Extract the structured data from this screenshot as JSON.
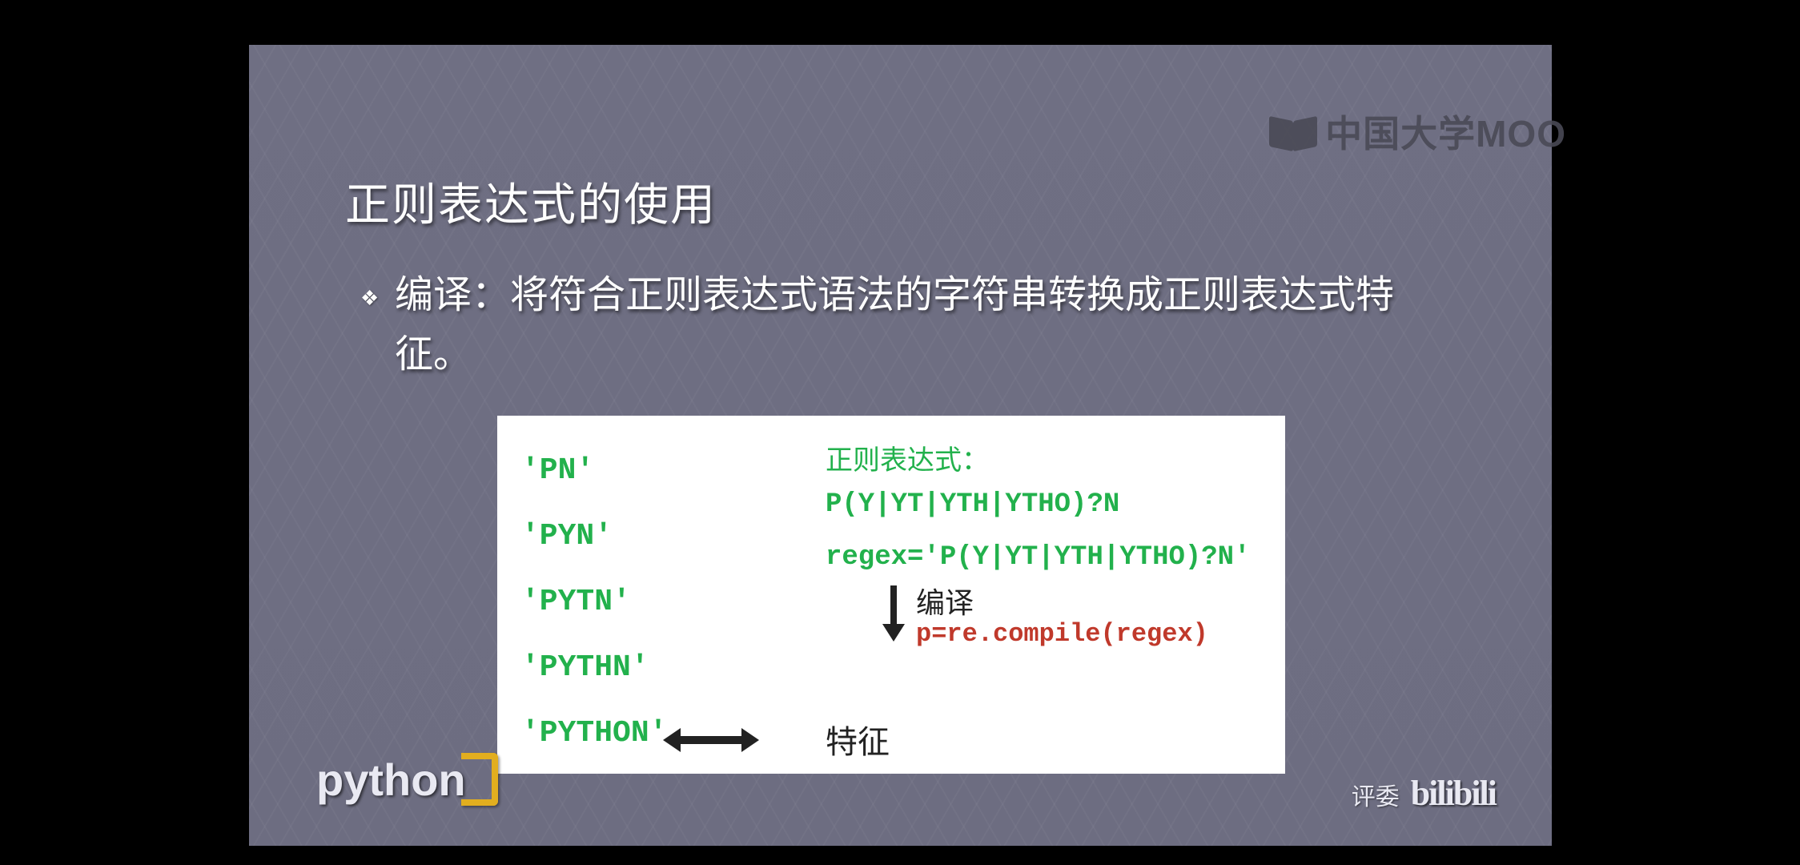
{
  "slide": {
    "title": "正则表达式的使用",
    "bullet": "编译：将符合正则表达式语法的字符串转换成正则表达式特征。"
  },
  "box": {
    "strings": [
      "'PN'",
      "'PYN'",
      "'PYTN'",
      "'PYTHN'",
      "'PYTHON'"
    ],
    "regex_label": "正则表达式：",
    "regex_expr": "P(Y|YT|YTH|YTHO)?N",
    "regex_assign": "regex='P(Y|YT|YTH|YTHO)?N'",
    "compile_word": "编译",
    "compile_code": "p=re.compile(regex)",
    "feature_label": "特征"
  },
  "brand": {
    "mooc": "中国大学MOO",
    "python": "python",
    "bili_label": "评委",
    "bili_logo": "bilibili"
  }
}
